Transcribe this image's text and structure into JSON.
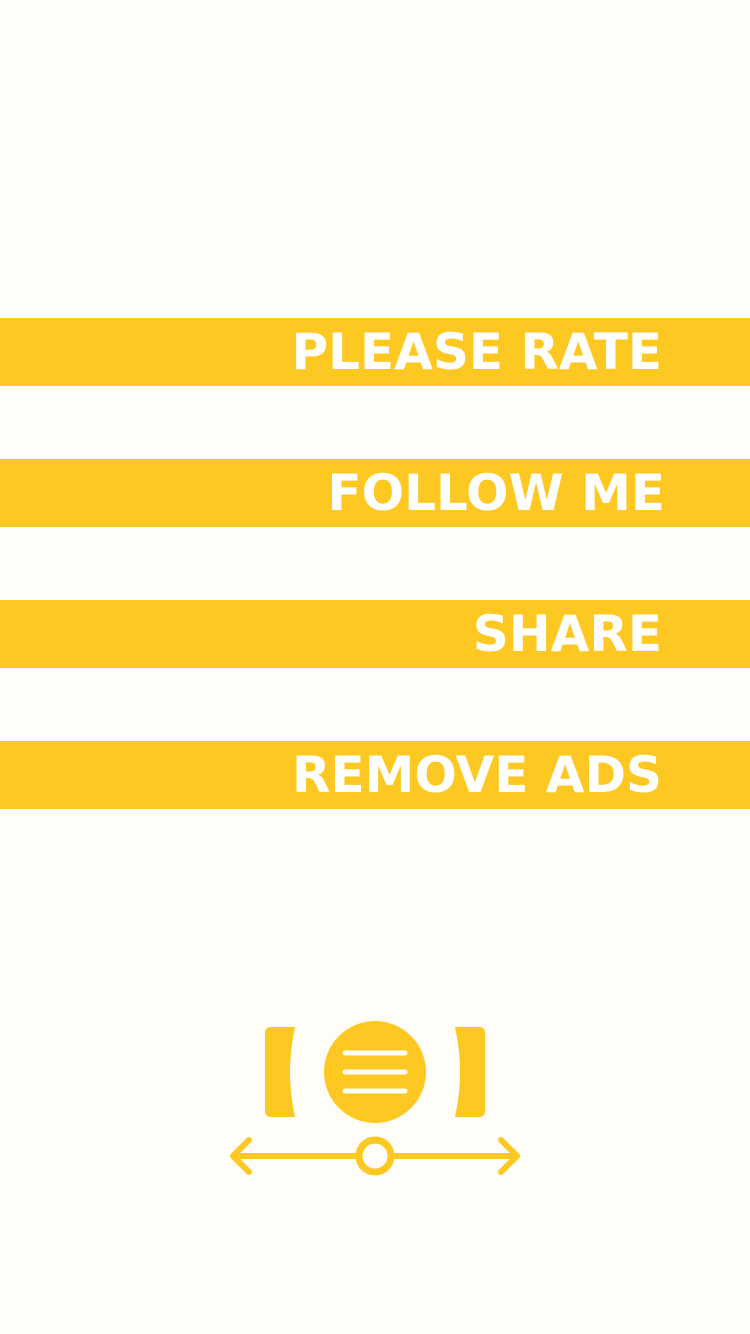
{
  "menu": {
    "items": [
      {
        "id": "rate",
        "label": "PLEASE RATE"
      },
      {
        "id": "follow",
        "label": "FOLLOW ME"
      },
      {
        "id": "share",
        "label": "SHARE"
      },
      {
        "id": "remove_ads",
        "label": "REMOVE ADS"
      }
    ]
  },
  "logo": {
    "icon": "menu-slider-logo-icon"
  },
  "colors": {
    "accent": "#fdc822",
    "background": "#fffdf8",
    "label_text": "#ffffff"
  }
}
